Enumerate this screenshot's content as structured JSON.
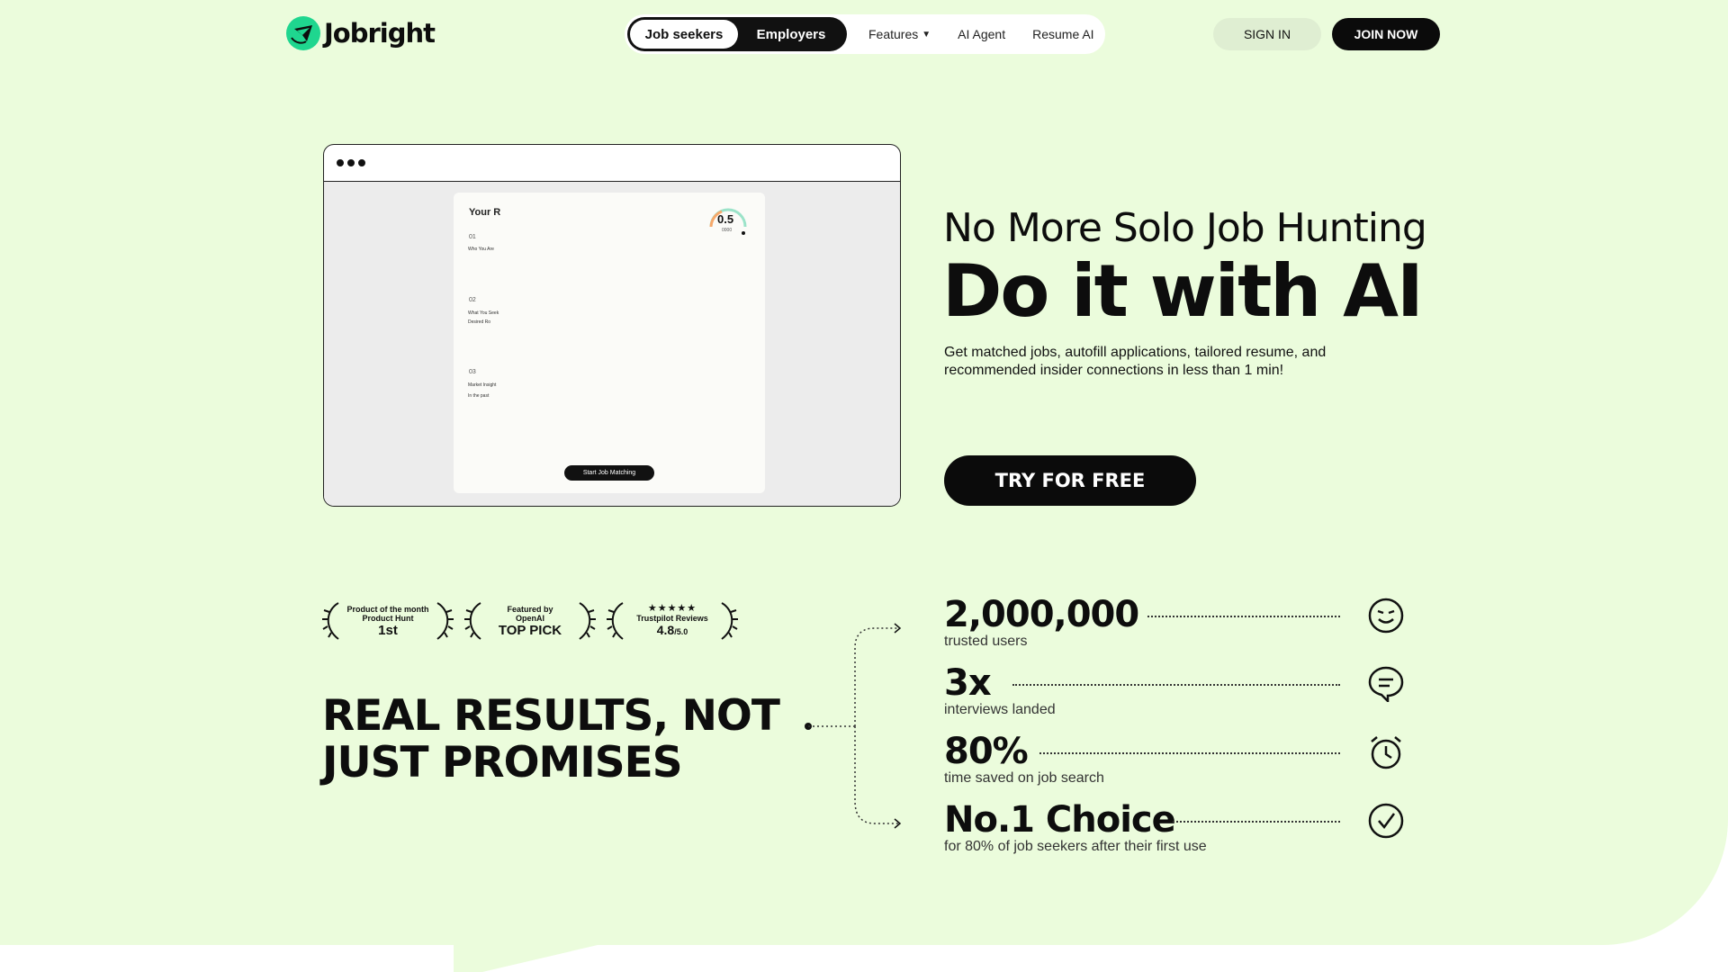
{
  "brand": {
    "name": "Jobright",
    "accent": "#1fd68f",
    "background": "#ebfcdc"
  },
  "nav": {
    "segment": {
      "active": "Job seekers",
      "inactive": "Employers"
    },
    "links": [
      {
        "label": "Features",
        "icon": "caret-down-icon"
      },
      {
        "label": "AI Agent"
      },
      {
        "label": "Resume AI"
      }
    ],
    "signin": "SIGN IN",
    "join": "JOIN NOW"
  },
  "mock": {
    "card_title": "Your R",
    "score": "0.5",
    "score_sub": "0000",
    "steps": [
      {
        "num": "01",
        "text": "Who You Are"
      },
      {
        "num": "02",
        "text": "What You Seek",
        "sub": "Desired Ro"
      },
      {
        "num": "03",
        "text": "Market Insight",
        "sub": "In the past"
      }
    ],
    "button": "Start Job Matching"
  },
  "hero": {
    "subtitle": "No More Solo Job Hunting",
    "title": "Do it with AI",
    "description": "Get matched jobs, autofill applications, tailored resume, and recommended insider connections in less than 1 min!",
    "cta": "TRY FOR FREE"
  },
  "awards": [
    {
      "line1": "Product of the month",
      "line2": "Product Hunt",
      "big": "1st"
    },
    {
      "line1": "Featured by",
      "line2": "OpenAI",
      "big": "TOP PICK"
    },
    {
      "stars": "★★★★★",
      "line1": "Trustpilot Reviews",
      "rating": "4.8",
      "rating_suffix": "/5.0"
    }
  ],
  "results_heading": "REAL RESULTS, NOT JUST PROMISES",
  "stats": [
    {
      "value": "2,000,000",
      "label": "trusted users",
      "icon": "smiley-face-icon"
    },
    {
      "value": "3x",
      "label": "interviews landed",
      "icon": "chat-bubble-icon"
    },
    {
      "value": "80%",
      "label": "time saved on job search",
      "icon": "alarm-clock-icon"
    },
    {
      "value": "No.1 Choice",
      "label": "for 80% of job seekers after their first use",
      "icon": "check-circle-icon"
    }
  ]
}
